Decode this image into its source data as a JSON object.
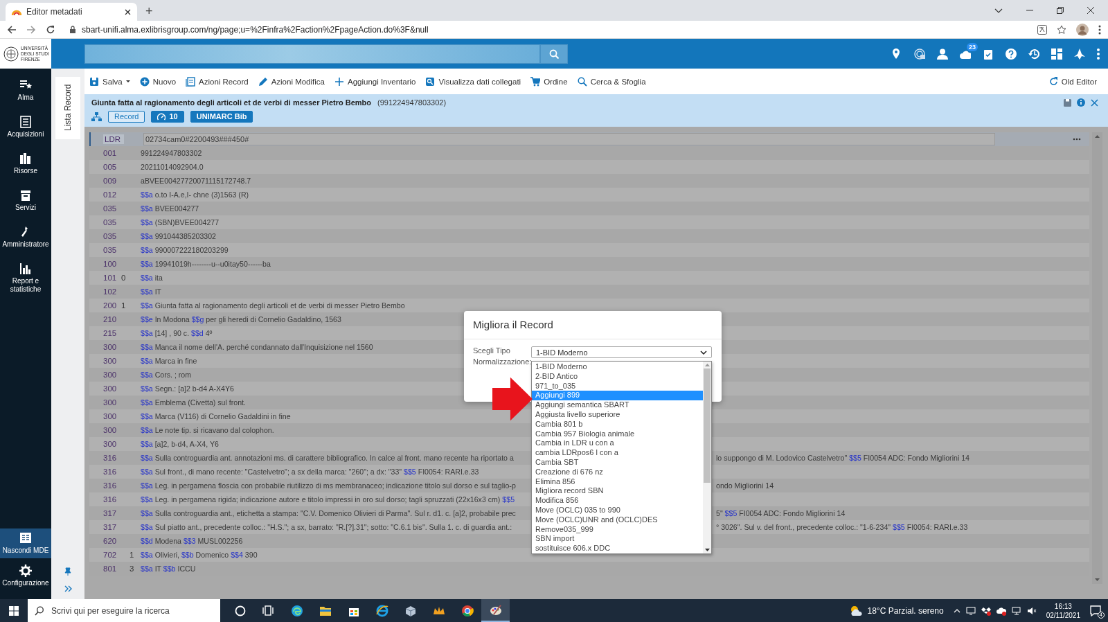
{
  "browser": {
    "tab_title": "Editor metadati",
    "new_tab": "+",
    "url": "sbart-unifi.alma.exlibrisgroup.com/ng/page;u=%2Finfra%2Faction%2FpageAction.do%3F&null"
  },
  "app_header": {
    "logo_lines": [
      "UNIVERSITÀ",
      "DEGLI STUDI",
      "FIRENZE"
    ],
    "icons": [
      {
        "kind": "pin"
      },
      {
        "kind": "radar"
      },
      {
        "kind": "person"
      },
      {
        "kind": "cloud",
        "badge": "23"
      },
      {
        "kind": "clipboard"
      },
      {
        "kind": "help"
      },
      {
        "kind": "history"
      },
      {
        "kind": "grid"
      },
      {
        "kind": "plane"
      },
      {
        "kind": "kebab"
      }
    ]
  },
  "nav": {
    "items": [
      {
        "kind": "alma",
        "label": "Alma"
      },
      {
        "kind": "acq",
        "label": "Acquisizioni"
      },
      {
        "kind": "res",
        "label": "Risorse"
      },
      {
        "kind": "srv",
        "label": "Servizi"
      },
      {
        "kind": "adm",
        "label": "Amministratore"
      },
      {
        "kind": "rep",
        "label": "Report e statistiche"
      }
    ],
    "bottom": [
      {
        "kind": "mde",
        "label": "Nascondi MDE",
        "selected": true
      },
      {
        "kind": "cfg",
        "label": "Configurazione",
        "selected": false
      }
    ]
  },
  "side_panel": {
    "label": "Lista Record"
  },
  "toolbar": {
    "items": [
      {
        "kind": "save",
        "label": "Salva",
        "dropdown": true
      },
      {
        "kind": "new",
        "label": "Nuovo",
        "dropdown": false
      },
      {
        "kind": "list",
        "label": "Azioni Record",
        "dropdown": false
      },
      {
        "kind": "pencil",
        "label": "Azioni Modifica",
        "dropdown": false
      },
      {
        "kind": "plus",
        "label": "Aggiungi Inventario",
        "dropdown": false
      },
      {
        "kind": "view",
        "label": "Visualizza dati collegati",
        "dropdown": false
      },
      {
        "kind": "cart",
        "label": "Ordine",
        "dropdown": false
      },
      {
        "kind": "search",
        "label": "Cerca & Sfoglia",
        "dropdown": false
      }
    ],
    "old_editor": "Old Editor"
  },
  "record": {
    "title": "Giunta fatta al ragionamento degli articoli et de verbi di messer Pietro Bembo",
    "id": "(991224947803302)",
    "badges": [
      {
        "kind": "outline",
        "label": "Record"
      },
      {
        "kind": "gauge",
        "label": "10"
      },
      {
        "kind": "solid",
        "label": "UNIMARC Bib"
      }
    ]
  },
  "fields": [
    {
      "kind": "leader",
      "tag": "LDR",
      "value": [
        {
          "text": "02734cam0#2200493###450#"
        }
      ]
    },
    {
      "kind": "data",
      "tag": "001",
      "value": [
        {
          "text": "991224947803302"
        }
      ]
    },
    {
      "kind": "data",
      "tag": "005",
      "value": [
        {
          "text": "20211014092904.0"
        }
      ]
    },
    {
      "kind": "data",
      "tag": "009",
      "value": [
        {
          "text": "aBVEE00427720071115172748.7"
        }
      ]
    },
    {
      "kind": "data",
      "tag": "012",
      "value": [
        {
          "code": "$$a",
          "text": "o.to I-A.e,I- chne (3)1563 (R)"
        }
      ]
    },
    {
      "kind": "data",
      "tag": "035",
      "value": [
        {
          "code": "$$a",
          "text": "BVEE004277"
        }
      ]
    },
    {
      "kind": "data",
      "tag": "035",
      "value": [
        {
          "code": "$$a",
          "text": "(SBN)BVEE004277"
        }
      ]
    },
    {
      "kind": "data",
      "tag": "035",
      "value": [
        {
          "code": "$$a",
          "text": "991044385203302"
        }
      ]
    },
    {
      "kind": "data",
      "tag": "035",
      "value": [
        {
          "code": "$$a",
          "text": "990007222180203299"
        }
      ]
    },
    {
      "kind": "data",
      "tag": "100",
      "value": [
        {
          "code": "$$a",
          "text": "19941019h--------u--u0itay50------ba"
        }
      ]
    },
    {
      "kind": "data",
      "tag": "101",
      "ind1": "0",
      "value": [
        {
          "code": "$$a",
          "text": "ita"
        }
      ]
    },
    {
      "kind": "data",
      "tag": "102",
      "value": [
        {
          "code": "$$a",
          "text": "IT"
        }
      ]
    },
    {
      "kind": "data",
      "tag": "200",
      "ind1": "1",
      "value": [
        {
          "code": "$$a",
          "text": "Giunta fatta al ragionamento degli articoli et de verbi di messer Pietro Bembo"
        }
      ]
    },
    {
      "kind": "data",
      "tag": "210",
      "value": [
        {
          "code": "$$e",
          "text": "In Modona"
        },
        {
          "code": "$$g",
          "text": "per gli heredi di Cornelio Gadaldino, 1563"
        }
      ]
    },
    {
      "kind": "data",
      "tag": "215",
      "value": [
        {
          "code": "$$a",
          "text": "[14] , 90 c."
        },
        {
          "code": "$$d",
          "text": "4º"
        }
      ]
    },
    {
      "kind": "data",
      "tag": "300",
      "value": [
        {
          "code": "$$a",
          "text": "Manca il nome dell'A. perché condannato dall'Inquisizione nel 1560"
        }
      ]
    },
    {
      "kind": "data",
      "tag": "300",
      "value": [
        {
          "code": "$$a",
          "text": "Marca in fine"
        }
      ]
    },
    {
      "kind": "data",
      "tag": "300",
      "value": [
        {
          "code": "$$a",
          "text": "Cors. ; rom"
        }
      ]
    },
    {
      "kind": "data",
      "tag": "300",
      "value": [
        {
          "code": "$$a",
          "text": "Segn.: [a]2 b-d4 A-X4Y6"
        }
      ]
    },
    {
      "kind": "data",
      "tag": "300",
      "value": [
        {
          "code": "$$a",
          "text": "Emblema (Civetta) sul front."
        }
      ]
    },
    {
      "kind": "data",
      "tag": "300",
      "value": [
        {
          "code": "$$a",
          "text": "Marca (V116) di Cornelio Gadaldini in fine"
        }
      ]
    },
    {
      "kind": "data",
      "tag": "300",
      "value": [
        {
          "code": "$$a",
          "text": "Le note tip. si ricavano dal colophon."
        }
      ]
    },
    {
      "kind": "data",
      "tag": "300",
      "value": [
        {
          "code": "$$a",
          "text": "[a]2, b-d4, A-X4, Y6"
        }
      ]
    },
    {
      "kind": "data",
      "tag": "316",
      "value": [
        {
          "code": "$$a",
          "text": "Sulla controguardia ant. annotazioni ms. di carattere bibliografico. In calce al front. mano recente ha riportato a"
        }
      ],
      "tail": [
        {
          "text": "lo suppongo di M. Lodovico Castelvetro\""
        },
        {
          "code": "$$5",
          "text": "FI0054 ADC: Fondo Migliorini 14"
        }
      ]
    },
    {
      "kind": "data",
      "tag": "316",
      "value": [
        {
          "code": "$$a",
          "text": "Sul front., di mano recente: \"Castelvetro\"; a sx della marca: \"260\"; a dx: \"33\""
        },
        {
          "code": "$$5",
          "text": "FI0054: RARI.e.33"
        }
      ]
    },
    {
      "kind": "data",
      "tag": "316",
      "value": [
        {
          "code": "$$a",
          "text": "Leg. in pergamena floscia con probabile riutilizzo di ms membranaceo; indicazione titolo sul dorso e sul taglio-p"
        }
      ],
      "tail": [
        {
          "text": "ondo Migliorini 14"
        }
      ]
    },
    {
      "kind": "data",
      "tag": "316",
      "value": [
        {
          "code": "$$a",
          "text": "Leg. in pergamena rigida; indicazione autore e titolo impressi in oro sul dorso; tagli spruzzati (22x16x3 cm)"
        },
        {
          "code": "$$5"
        }
      ]
    },
    {
      "kind": "data",
      "tag": "317",
      "value": [
        {
          "code": "$$a",
          "text": "Sulla controguardia ant., etichetta a stampa: \"C.V. Domenico Olivieri di Parma\". Sul r. d1. c. [a]2, probabile prec"
        }
      ],
      "tail": [
        {
          "text": "5\""
        },
        {
          "code": "$$5",
          "text": "FI0054 ADC: Fondo Migliorini 14"
        }
      ]
    },
    {
      "kind": "data",
      "tag": "317",
      "value": [
        {
          "code": "$$a",
          "text": "Sul piatto ant., precedente colloc.: \"H.S.\"; a sx, barrato: \"R.[?].31\"; sotto: \"C.6.1 bis\". Sulla 1. c. di guardia ant.:"
        }
      ],
      "tail": [
        {
          "text": "° 3026\". Sul v. del front., precedente colloc.: \"1-6-234\""
        },
        {
          "code": "$$5",
          "text": "FI0054: RARI.e.33"
        }
      ]
    },
    {
      "kind": "data",
      "tag": "620",
      "value": [
        {
          "code": "$$d",
          "text": "Modena"
        },
        {
          "code": "$$3",
          "text": "MUSL002256"
        }
      ]
    },
    {
      "kind": "data",
      "tag": "702",
      "ind2": "1",
      "value": [
        {
          "code": "$$a",
          "text": "Olivieri,"
        },
        {
          "code": "$$b",
          "text": "Domenico"
        },
        {
          "code": "$$4",
          "text": "390"
        }
      ]
    },
    {
      "kind": "data",
      "tag": "801",
      "ind2": "3",
      "value": [
        {
          "code": "$$a",
          "text": "IT"
        },
        {
          "code": "$$b",
          "text": "ICCU"
        }
      ]
    }
  ],
  "dialog": {
    "title": "Migliora il Record",
    "type_label": "Scegli Tipo",
    "norm_label": "Normalizzazione:",
    "select_value": "1-BID Moderno",
    "options": [
      {
        "label": "1-BID Moderno",
        "selected": false
      },
      {
        "label": "2-BID Antico",
        "selected": false
      },
      {
        "label": "971_to_035",
        "selected": false
      },
      {
        "label": "Aggiungi 899",
        "selected": true
      },
      {
        "label": "Aggiungi semantica SBART",
        "selected": false
      },
      {
        "label": "Aggiusta livello superiore",
        "selected": false
      },
      {
        "label": "Cambia 801 b",
        "selected": false
      },
      {
        "label": "Cambia 957 Biologia animale",
        "selected": false
      },
      {
        "label": "Cambia in LDR u con a",
        "selected": false
      },
      {
        "label": "cambia LDRpos6 l con a",
        "selected": false
      },
      {
        "label": "Cambia SBT",
        "selected": false
      },
      {
        "label": "Creazione di 676 nz",
        "selected": false
      },
      {
        "label": "Elimina 856",
        "selected": false
      },
      {
        "label": "Migliora record SBN",
        "selected": false
      },
      {
        "label": "Modifica 856",
        "selected": false
      },
      {
        "label": "Move (OCLC) 035 to 990",
        "selected": false
      },
      {
        "label": "Move (OCLC)UNR and (OCLC)DES",
        "selected": false
      },
      {
        "label": "Remove035_999",
        "selected": false
      },
      {
        "label": "SBN import",
        "selected": false
      },
      {
        "label": "sostituisce 606.x DDC",
        "selected": false
      }
    ]
  },
  "taskbar": {
    "search_placeholder": "Scrivi qui per eseguire la ricerca",
    "weather": "18°C Parzial. sereno",
    "time": "16:13",
    "date": "02/11/2021",
    "notifications": "4"
  }
}
